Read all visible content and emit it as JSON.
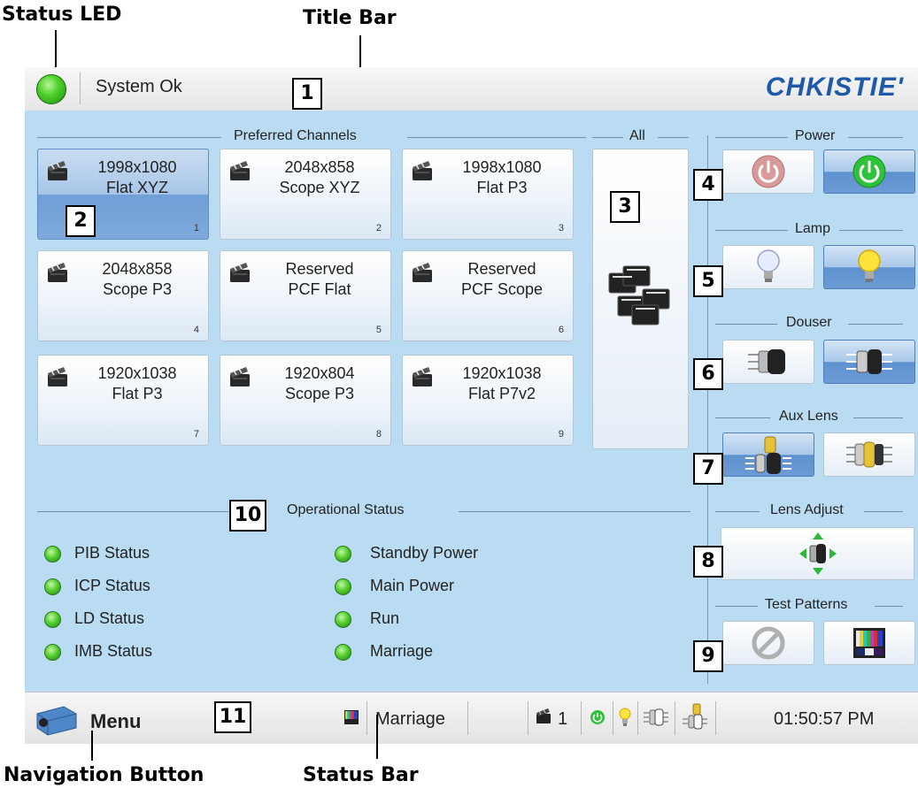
{
  "callouts": {
    "status_led": "Status LED",
    "title_bar": "Title Bar",
    "navigation_button": "Navigation Button",
    "status_bar": "Status Bar"
  },
  "badges": [
    "1",
    "2",
    "3",
    "4",
    "5",
    "6",
    "7",
    "8",
    "9",
    "10",
    "11"
  ],
  "titlebar": {
    "status_text": "System Ok",
    "logo": "CHKISTIE'"
  },
  "preferred": {
    "heading": "Preferred Channels",
    "all_heading": "All",
    "channels": [
      {
        "line1": "1998x1080",
        "line2": "Flat XYZ",
        "num": "1",
        "selected": true
      },
      {
        "line1": "2048x858",
        "line2": "Scope XYZ",
        "num": "2"
      },
      {
        "line1": "1998x1080",
        "line2": "Flat P3",
        "num": "3"
      },
      {
        "line1": "2048x858",
        "line2": "Scope P3",
        "num": "4"
      },
      {
        "line1": "Reserved",
        "line2": "PCF Flat",
        "num": "5"
      },
      {
        "line1": "Reserved",
        "line2": "PCF Scope",
        "num": "6"
      },
      {
        "line1": "1920x1038",
        "line2": "Flat P3",
        "num": "7"
      },
      {
        "line1": "1920x804",
        "line2": "Scope P3",
        "num": "8"
      },
      {
        "line1": "1920x1038",
        "line2": "Flat P7v2",
        "num": "9"
      }
    ]
  },
  "side": {
    "power": "Power",
    "lamp": "Lamp",
    "douser": "Douser",
    "aux_lens": "Aux Lens",
    "lens_adjust": "Lens Adjust",
    "test_patterns": "Test Patterns"
  },
  "operational": {
    "heading": "Operational Status",
    "left": [
      "PIB Status",
      "ICP Status",
      "LD Status",
      "IMB Status"
    ],
    "right": [
      "Standby Power",
      "Main Power",
      "Run",
      "Marriage"
    ]
  },
  "statusbar": {
    "menu": "Menu",
    "marriage": "Marriage",
    "channel": "1",
    "time": "01:50:57 PM"
  },
  "colors": {
    "panel": "#b9dcf3",
    "selected": "#6f9fd6",
    "led_green": "#4fd22b",
    "logo_blue": "#1f5aa8"
  }
}
